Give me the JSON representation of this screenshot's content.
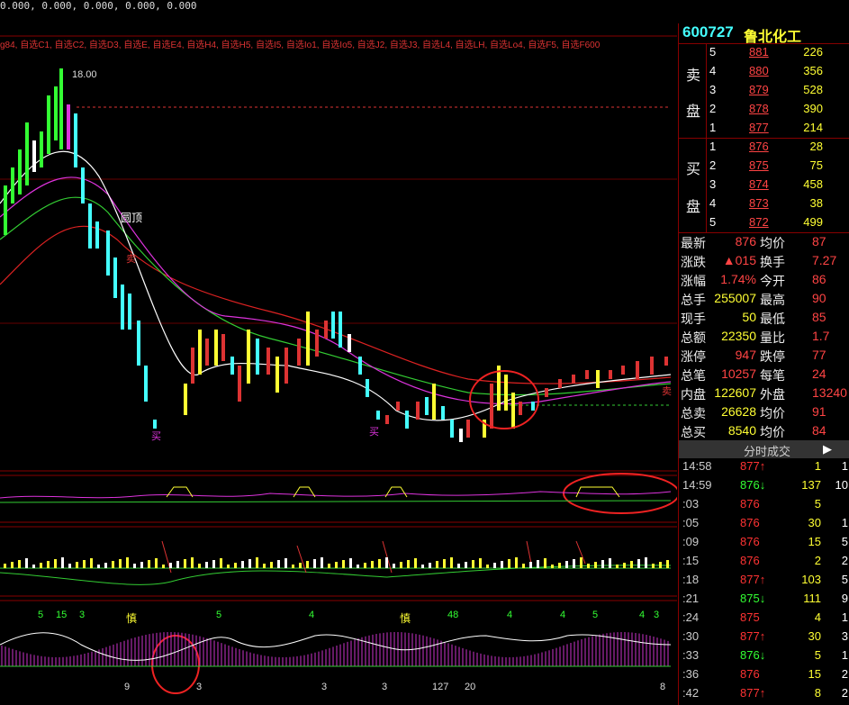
{
  "top": {
    "values": "0.000,  0.000,  0.000,  0.000,  0.000"
  },
  "indicators": "g84, 自选C1, 自选C2, 自选D3, 自选E, 自选E4, 自选H4, 自选H5, 自选I5, 自选Io1, 自选Io5, 自选J2, 自选J3, 自选L4, 自选LH, 自选Lo4, 自选F5, 自选F600",
  "chart_labels": {
    "high": "18.00",
    "round_top": "圆顶",
    "buy": "买",
    "sell": "卖",
    "shen": "慎",
    "bottom_nums": [
      "5",
      "15",
      "3",
      "5",
      "4",
      "48",
      "4",
      "4",
      "5",
      "4",
      "3",
      "9",
      "3",
      "3",
      "127",
      "20",
      "3",
      "8"
    ]
  },
  "stock": {
    "code": "600727",
    "name": "鲁北化工"
  },
  "sell_side": {
    "label_top": "卖",
    "label_bottom": "盘"
  },
  "buy_side": {
    "label_top": "买",
    "label_bottom": "盘"
  },
  "asks": [
    {
      "level": "5",
      "price": "881",
      "qty": "226"
    },
    {
      "level": "4",
      "price": "880",
      "qty": "356"
    },
    {
      "level": "3",
      "price": "879",
      "qty": "528"
    },
    {
      "level": "2",
      "price": "878",
      "qty": "390"
    },
    {
      "level": "1",
      "price": "877",
      "qty": "214"
    }
  ],
  "bids": [
    {
      "level": "1",
      "price": "876",
      "qty": "28"
    },
    {
      "level": "2",
      "price": "875",
      "qty": "75"
    },
    {
      "level": "3",
      "price": "874",
      "qty": "458"
    },
    {
      "level": "4",
      "price": "873",
      "qty": "38"
    },
    {
      "level": "5",
      "price": "872",
      "qty": "499"
    }
  ],
  "quote": [
    {
      "k": "最新",
      "v": "876",
      "k2": "均价",
      "v2": "87"
    },
    {
      "k": "涨跌",
      "v": "▲015",
      "k2": "换手",
      "v2": "7.27"
    },
    {
      "k": "涨幅",
      "v": "1.74%",
      "k2": "今开",
      "v2": "86"
    },
    {
      "k": "总手",
      "v": "255007",
      "k2": "最高",
      "v2": "90"
    },
    {
      "k": "现手",
      "v": "50",
      "k2": "最低",
      "v2": "85"
    },
    {
      "k": "总额",
      "v": "22350",
      "k2": "量比",
      "v2": "1.7"
    },
    {
      "k": "涨停",
      "v": "947",
      "k2": "跌停",
      "v2": "77"
    },
    {
      "k": "总笔",
      "v": "10257",
      "k2": "每笔",
      "v2": "24"
    },
    {
      "k": "内盘",
      "v": "122607",
      "k2": "外盘",
      "v2": "13240"
    },
    {
      "k": "总卖",
      "v": "26628",
      "k2": "均价",
      "v2": "91"
    },
    {
      "k": "总买",
      "v": "8540",
      "k2": "均价",
      "v2": "84"
    }
  ],
  "trades_title": "分时成交",
  "trades_arrow": "▶",
  "trades": [
    {
      "t": "14:58",
      "p": "877↑",
      "v": "1",
      "n": "1",
      "up": true
    },
    {
      "t": "14:59",
      "p": "876↓",
      "v": "137",
      "n": "10",
      "up": false
    },
    {
      "t": ":03",
      "p": "876",
      "v": "5",
      "n": "",
      "up": true
    },
    {
      "t": ":05",
      "p": "876",
      "v": "30",
      "n": "1",
      "up": true
    },
    {
      "t": ":09",
      "p": "876",
      "v": "15",
      "n": "5",
      "up": true
    },
    {
      "t": ":15",
      "p": "876",
      "v": "2",
      "n": "2",
      "up": true
    },
    {
      "t": ":18",
      "p": "877↑",
      "v": "103",
      "n": "5",
      "up": true
    },
    {
      "t": ":21",
      "p": "875↓",
      "v": "111",
      "n": "9",
      "up": false
    },
    {
      "t": ":24",
      "p": "875",
      "v": "4",
      "n": "1",
      "up": true
    },
    {
      "t": ":30",
      "p": "877↑",
      "v": "30",
      "n": "3",
      "up": true
    },
    {
      "t": ":33",
      "p": "876↓",
      "v": "5",
      "n": "1",
      "up": false
    },
    {
      "t": ":36",
      "p": "876",
      "v": "15",
      "n": "2",
      "up": true
    },
    {
      "t": ":42",
      "p": "877↑",
      "v": "8",
      "n": "2",
      "up": true
    }
  ],
  "colors": {
    "up": "#ff3333",
    "down": "#33ff33",
    "yellow": "#ffff33",
    "cyan": "#44ffff",
    "frame": "#880000"
  }
}
